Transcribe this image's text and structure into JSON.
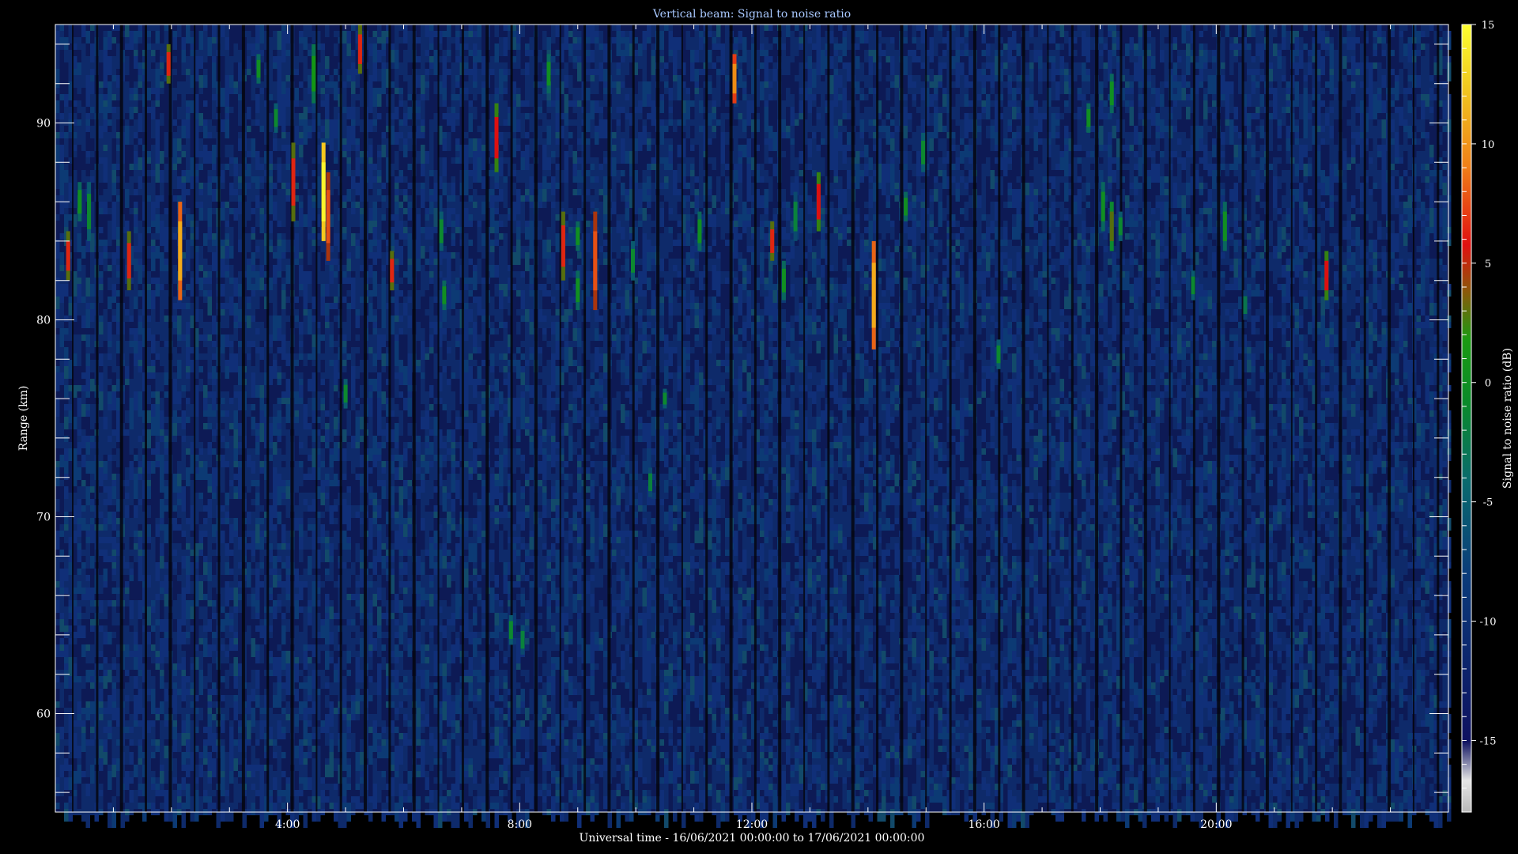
{
  "chart_data": {
    "type": "heatmap",
    "title": "Vertical beam: Signal to noise ratio",
    "xlabel": "Universal time - 16/06/2021 00:00:00 to 17/06/2021 00:00:00",
    "ylabel": "Range (km)",
    "colorbar_label": "Signal to noise ratio (dB)",
    "x_unit": "hours UT",
    "xlim": [
      0,
      24
    ],
    "ylim": [
      55,
      95
    ],
    "zlim": [
      -18,
      15
    ],
    "x_ticks": [
      {
        "value": 4,
        "label": "4:00"
      },
      {
        "value": 8,
        "label": "8:00"
      },
      {
        "value": 12,
        "label": "12:00"
      },
      {
        "value": 16,
        "label": "16:00"
      },
      {
        "value": 20,
        "label": "20:00"
      }
    ],
    "y_ticks": [
      {
        "value": 60,
        "label": "60"
      },
      {
        "value": 70,
        "label": "70"
      },
      {
        "value": 80,
        "label": "80"
      },
      {
        "value": 90,
        "label": "90"
      }
    ],
    "colorbar_ticks": [
      {
        "value": 15,
        "label": "15"
      },
      {
        "value": 10,
        "label": "10"
      },
      {
        "value": 5,
        "label": "5"
      },
      {
        "value": 0,
        "label": "0"
      },
      {
        "value": -5,
        "label": "-5"
      },
      {
        "value": -10,
        "label": "-10"
      },
      {
        "value": -15,
        "label": "-15"
      }
    ],
    "background_snr": -16,
    "echoes": [
      {
        "t": 0.22,
        "r0": 82.0,
        "r1": 84.5,
        "snr": 1
      },
      {
        "t": 0.42,
        "r0": 85.0,
        "r1": 87.0,
        "snr": -6
      },
      {
        "t": 0.58,
        "r0": 84.0,
        "r1": 87.0,
        "snr": -7
      },
      {
        "t": 1.27,
        "r0": 81.5,
        "r1": 84.5,
        "snr": 1
      },
      {
        "t": 1.95,
        "r0": 92.0,
        "r1": 94.0,
        "snr": 1
      },
      {
        "t": 2.15,
        "r0": 81.0,
        "r1": 86.0,
        "snr": 8
      },
      {
        "t": 3.5,
        "r0": 92.0,
        "r1": 93.5,
        "snr": -6
      },
      {
        "t": 3.8,
        "r0": 89.5,
        "r1": 91.0,
        "snr": -7
      },
      {
        "t": 4.1,
        "r0": 85.0,
        "r1": 89.0,
        "snr": 1
      },
      {
        "t": 4.45,
        "r0": 91.0,
        "r1": 94.0,
        "snr": -5
      },
      {
        "t": 4.62,
        "r0": 84.0,
        "r1": 89.0,
        "snr": 14
      },
      {
        "t": 4.7,
        "r0": 83.0,
        "r1": 87.5,
        "snr": 3
      },
      {
        "t": 5.0,
        "r0": 75.5,
        "r1": 77.0,
        "snr": -7
      },
      {
        "t": 5.25,
        "r0": 92.5,
        "r1": 95.0,
        "snr": 1
      },
      {
        "t": 5.8,
        "r0": 81.5,
        "r1": 83.5,
        "snr": 1
      },
      {
        "t": 6.65,
        "r0": 83.5,
        "r1": 85.5,
        "snr": -7
      },
      {
        "t": 6.7,
        "r0": 80.5,
        "r1": 82.0,
        "snr": -6
      },
      {
        "t": 7.6,
        "r0": 87.5,
        "r1": 91.0,
        "snr": 0
      },
      {
        "t": 7.85,
        "r0": 63.5,
        "r1": 65.0,
        "snr": -7
      },
      {
        "t": 8.05,
        "r0": 63.0,
        "r1": 64.5,
        "snr": -8
      },
      {
        "t": 8.5,
        "r0": 91.5,
        "r1": 93.5,
        "snr": -6
      },
      {
        "t": 8.75,
        "r0": 82.0,
        "r1": 85.5,
        "snr": 1
      },
      {
        "t": 9.0,
        "r0": 80.5,
        "r1": 82.5,
        "snr": -6
      },
      {
        "t": 9.0,
        "r0": 83.5,
        "r1": 85.0,
        "snr": -6
      },
      {
        "t": 9.3,
        "r0": 80.5,
        "r1": 85.5,
        "snr": 3
      },
      {
        "t": 9.95,
        "r0": 82.0,
        "r1": 84.0,
        "snr": -7
      },
      {
        "t": 10.25,
        "r0": 71.0,
        "r1": 72.5,
        "snr": -8
      },
      {
        "t": 10.5,
        "r0": 75.5,
        "r1": 76.5,
        "snr": -7
      },
      {
        "t": 11.1,
        "r0": 83.5,
        "r1": 85.5,
        "snr": -6
      },
      {
        "t": 11.7,
        "r0": 91.0,
        "r1": 93.5,
        "snr": 6
      },
      {
        "t": 12.35,
        "r0": 83.0,
        "r1": 85.0,
        "snr": 1
      },
      {
        "t": 12.55,
        "r0": 81.0,
        "r1": 83.0,
        "snr": -6
      },
      {
        "t": 12.75,
        "r0": 84.0,
        "r1": 86.5,
        "snr": -8
      },
      {
        "t": 13.15,
        "r0": 84.5,
        "r1": 87.5,
        "snr": 0
      },
      {
        "t": 14.1,
        "r0": 78.5,
        "r1": 84.0,
        "snr": 8
      },
      {
        "t": 14.65,
        "r0": 85.0,
        "r1": 86.5,
        "snr": -6
      },
      {
        "t": 14.95,
        "r0": 87.5,
        "r1": 89.5,
        "snr": -7
      },
      {
        "t": 16.25,
        "r0": 77.5,
        "r1": 79.0,
        "snr": -7
      },
      {
        "t": 17.8,
        "r0": 89.5,
        "r1": 91.0,
        "snr": -6
      },
      {
        "t": 18.05,
        "r0": 84.5,
        "r1": 87.0,
        "snr": -6
      },
      {
        "t": 18.2,
        "r0": 83.5,
        "r1": 86.0,
        "snr": -3
      },
      {
        "t": 18.35,
        "r0": 84.0,
        "r1": 85.5,
        "snr": -7
      },
      {
        "t": 18.2,
        "r0": 90.5,
        "r1": 92.5,
        "snr": -6
      },
      {
        "t": 19.6,
        "r0": 81.0,
        "r1": 82.5,
        "snr": -7
      },
      {
        "t": 20.15,
        "r0": 83.5,
        "r1": 86.0,
        "snr": -6
      },
      {
        "t": 20.5,
        "r0": 80.0,
        "r1": 81.5,
        "snr": -9
      },
      {
        "t": 21.9,
        "r0": 81.0,
        "r1": 83.5,
        "snr": 0
      }
    ]
  }
}
